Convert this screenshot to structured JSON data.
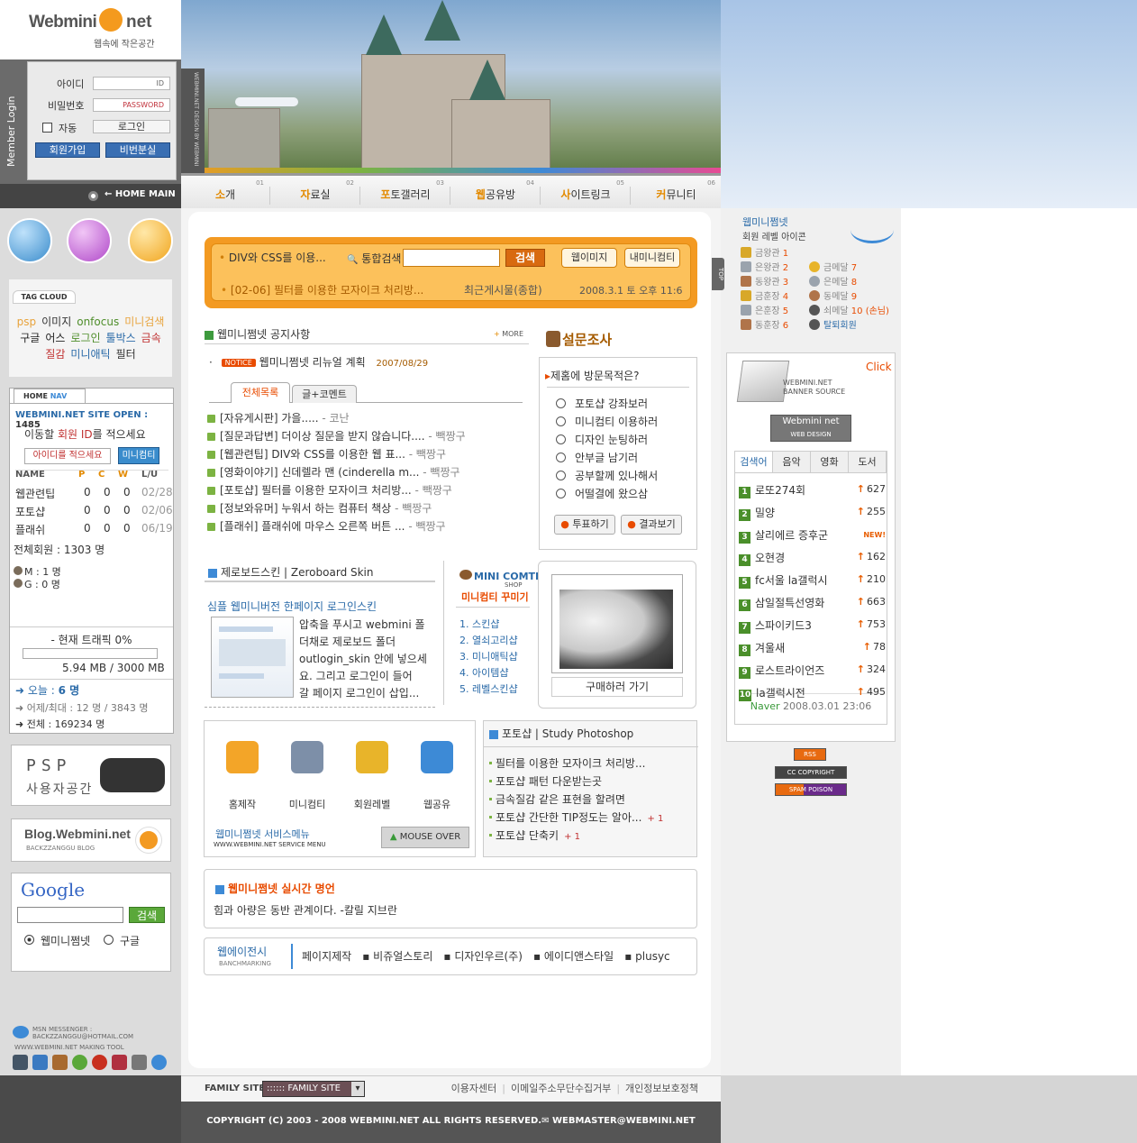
{
  "logo": {
    "text": "Webmini",
    "net": "net",
    "subtitle": "웹속에 작은공간"
  },
  "header": {
    "vertical_label": "WEBMINI.NET DESIGN BY WEBMINI"
  },
  "nav": [
    {
      "lead": "소",
      "rest": "개",
      "num": "01"
    },
    {
      "lead": "자",
      "rest": "료실",
      "num": "02"
    },
    {
      "lead": "포",
      "rest": "토갤러리",
      "num": "03"
    },
    {
      "lead": "웹",
      "rest": "공유방",
      "num": "04"
    },
    {
      "lead": "사",
      "rest": "이트링크",
      "num": "05"
    },
    {
      "lead": "커",
      "rest": "뮤니티",
      "num": "06"
    }
  ],
  "login": {
    "section_label": "Member Login",
    "id_label": "아이디",
    "id_placeholder": "ID",
    "pw_label": "비밀번호",
    "pw_placeholder": "PASSWORD",
    "auto_label": "자동",
    "login_button": "로그인",
    "join_button": "회원가입",
    "lost_button": "비번분실",
    "home_main": "← HOME MAIN"
  },
  "tag_cloud": {
    "title": "TAG CLOUD",
    "tags": [
      {
        "t": "psp",
        "c": "#e8a33c"
      },
      {
        "t": "이미지",
        "c": "#333"
      },
      {
        "t": "onfocus",
        "c": "#4f8e2b"
      },
      {
        "t": "미니검색",
        "c": "#e8a33c"
      },
      {
        "t": "구글",
        "c": "#222"
      },
      {
        "t": "어스",
        "c": "#222"
      },
      {
        "t": "로그인",
        "c": "#4f8e2b"
      },
      {
        "t": "툴박스",
        "c": "#2a6aa8"
      },
      {
        "t": "금속",
        "c": "#c03030"
      },
      {
        "t": "질감",
        "c": "#c03030"
      },
      {
        "t": "미니애틱",
        "c": "#2a6aa8"
      },
      {
        "t": "필터",
        "c": "#333"
      }
    ]
  },
  "site_box": {
    "tab_home": "HOME",
    "tab_nav": "NAV",
    "open_label": "WEBMINI.NET SITE OPEN :",
    "open_count": "1485",
    "move_prefix": "이동할 ",
    "move_mid": "회원 ID",
    "move_suffix": "를 적으세요",
    "id_input_value": "아이디를 적으세요",
    "go_button": "미니컴티",
    "table_headers": [
      "NAME",
      "P",
      "C",
      "W",
      "L/U"
    ],
    "table_rows": [
      [
        "웹관련팁",
        "0",
        "0",
        "0",
        "02/28"
      ],
      [
        "포토샵",
        "0",
        "0",
        "0",
        "02/06"
      ],
      [
        "플래쉬",
        "0",
        "0",
        "0",
        "06/19"
      ]
    ],
    "total_members": "전체회원 : 1303 명",
    "m_count": "M : 1 명",
    "g_count": "G : 0 명",
    "traffic_label": "- 현재 트래픽 0%",
    "traffic_value": "5.94 MB / 3000 MB",
    "today_label": "오늘 :",
    "today_value": "6 명",
    "yesterday": "어제/최대 : 12 명 / 3843 명",
    "total": "전체 : 169234 명"
  },
  "psp": {
    "line1": "PSP",
    "line2": "사용자공간"
  },
  "blog": {
    "title": "Blog.Webmini.net",
    "sub": "BACKZZANGGU BLOG"
  },
  "google": {
    "logo": "Google",
    "button": "검색",
    "opt1": "웹미니쩜넷",
    "opt2": "구글"
  },
  "messenger": {
    "line1": "MSN MESSENGER :",
    "line2": "BACKZZANGGU@HOTMAIL.COM",
    "line3": "WWW.WEBMINI.NET MAKING TOOL"
  },
  "search": {
    "ticker": "DIV와 CSS를 이용...",
    "label": "통합검색",
    "button": "검색",
    "btn_image": "웹이미지",
    "btn_comty": "내미니컴티",
    "latest": "[02-06] 필터를 이용한 모자이크 처리방...",
    "latest_cat": "최근게시물(종합)",
    "datetime": "2008.3.1 토 오후 11:6"
  },
  "notice": {
    "title": "웹미니쩜넷 공지사항",
    "more": "MORE",
    "badge": "NOTICE",
    "text": "웹미니쩜넷 리뉴얼 계획",
    "date": "2007/08/29"
  },
  "board_tabs": [
    "전체목록",
    "글+코멘트"
  ],
  "posts": [
    {
      "t": "[자유게시판] 가을.....",
      "w": "- 코난"
    },
    {
      "t": "[질문과답변] 더이상 질문을 받지 않습니다....",
      "w": "- 빽짱구"
    },
    {
      "t": "[웹관련팁] DIV와 CSS를 이용한 웹 표...",
      "w": "- 빽짱구"
    },
    {
      "t": "[영화이야기] 신데렐라 맨 (cinderella m...",
      "w": "- 빽짱구"
    },
    {
      "t": "[포토샵] 필터를 이용한 모자이크 처리방...",
      "w": "- 빽짱구"
    },
    {
      "t": "[정보와유머] 누워서 하는 컴퓨터 책상",
      "w": "- 빽짱구"
    },
    {
      "t": "[플래쉬] 플래쉬에 마우스 오른쪽 버튼 ...",
      "w": "- 빽짱구"
    }
  ],
  "poll": {
    "title": "설문조사",
    "question": "제홈에 방문목적은?",
    "options": [
      "포토샵 강좌보러",
      "미니컴티 이용하러",
      "디자인 눈팅하러",
      "안부글 남기러",
      "공부할께 있나해서",
      "어떨결에 왔으삼"
    ],
    "vote": "투표하기",
    "result": "결과보기"
  },
  "zb": {
    "title": "제로보드스킨 | Zeroboard Skin",
    "post_title": "심플 웹미니버전 한페이지 로그인스킨",
    "lines": [
      "압축을 푸시고 webmini 폴",
      "더채로 제로보드 폴더",
      "outlogin_skin 안에 넣으세",
      "요. 그리고 로그인이 들어",
      "갈 페이지 로그인이 삽입..."
    ]
  },
  "mini_shop": {
    "title": "MINI COMTI",
    "sub": "SHOP",
    "subtitle": "미니컴티 꾸미기",
    "items": [
      "1. 스킨샵",
      "2. 열쇠고리샵",
      "3. 미니애틱샵",
      "4. 아이템샵",
      "5. 레벨스킨샵"
    ]
  },
  "buy": {
    "label": "구매하러 가기"
  },
  "services": {
    "items": [
      "홈제작",
      "미니컴티",
      "회원레벨",
      "웹공유"
    ],
    "title": "웹미니쩜넷 서비스메뉴",
    "sub": "WWW.WEBMINI.NET SERVICE MENU",
    "mouseover": "MOUSE OVER"
  },
  "photoshop": {
    "title": "포토샵 | Study Photoshop",
    "items": [
      {
        "t": "필터를 이용한 모자이크 처리방...",
        "c": ""
      },
      {
        "t": "포토샵 패턴 다운받는곳",
        "c": ""
      },
      {
        "t": "금속질감 같은 표현을 할려면",
        "c": ""
      },
      {
        "t": "포토샵 간단한 TIP정도는 알아...",
        "c": "+ 1"
      },
      {
        "t": "포토샵 단축키",
        "c": "+ 1"
      }
    ]
  },
  "quote": {
    "title": "웹미니쩜넷 실시간 명언",
    "text": "힘과 아량은 동반 관계이다. -칼릴 지브란"
  },
  "agency": {
    "title": "웹에이전시",
    "sub": "BANCHMARKING",
    "links": [
      "페이지제작",
      "▪ 비쥬얼스토리",
      "▪ 디자인우르(주)",
      "▪ 에이디앤스타일",
      "▪ plusyc"
    ]
  },
  "footer": {
    "family_label": "FAMILY SITE",
    "family_select": ":::::: FAMILY SITE",
    "links": [
      "이용자센터",
      "이메일주소무단수집거부",
      "개인정보보호정책"
    ],
    "copyright": "COPYRIGHT (C) 2003 - 2008 WEBMINI.NET ALL RIGHTS RESERVED.✉ WEBMASTER@WEBMINI.NET"
  },
  "levels": {
    "title": "웹미니쩜넷",
    "sub": "회원 레벨 아이콘",
    "left": [
      {
        "n": "금왕관",
        "v": "1"
      },
      {
        "n": "은왕관",
        "v": "2"
      },
      {
        "n": "동왕관",
        "v": "3"
      },
      {
        "n": "금훈장",
        "v": "4"
      },
      {
        "n": "은훈장",
        "v": "5"
      },
      {
        "n": "동훈장",
        "v": "6"
      }
    ],
    "right": [
      {
        "n": "금메달",
        "v": "7"
      },
      {
        "n": "은메달",
        "v": "8"
      },
      {
        "n": "동메달",
        "v": "9"
      },
      {
        "n": "쇠메달",
        "v": "10 (손님)"
      },
      {
        "n": "탈퇴회원",
        "v": ""
      }
    ],
    "top_tab": "TOP"
  },
  "banner_src": {
    "click": "Click",
    "line1": "WEBMINI.NET",
    "line2": "BANNER SOURCE",
    "logo": "Webmini net",
    "logo_sub": "WEB DESIGN"
  },
  "rank": {
    "tabs": [
      "검색어",
      "음악",
      "영화",
      "도서"
    ],
    "items": [
      {
        "n": "1",
        "t": "로또274회",
        "v": "627",
        "up": true
      },
      {
        "n": "2",
        "t": "밀양",
        "v": "255",
        "up": true
      },
      {
        "n": "3",
        "t": "살리에르 증후군",
        "v": "NEW!",
        "up": false
      },
      {
        "n": "4",
        "t": "오현경",
        "v": "162",
        "up": true
      },
      {
        "n": "5",
        "t": "fc서울 la갤럭시",
        "v": "210",
        "up": true
      },
      {
        "n": "6",
        "t": "삼일절특선영화",
        "v": "663",
        "up": true
      },
      {
        "n": "7",
        "t": "스파이키드3",
        "v": "753",
        "up": true
      },
      {
        "n": "8",
        "t": "겨울새",
        "v": "78",
        "up": true
      },
      {
        "n": "9",
        "t": "로스트라이언즈",
        "v": "324",
        "up": true
      },
      {
        "n": "10",
        "t": "la갤럭시전",
        "v": "495",
        "up": true
      }
    ],
    "source": "Naver",
    "time": "2008.03.01 23:06"
  },
  "badges": {
    "rss": "RSS",
    "cc": "CC COPYRIGHT",
    "spam": "SPAM POISON"
  }
}
